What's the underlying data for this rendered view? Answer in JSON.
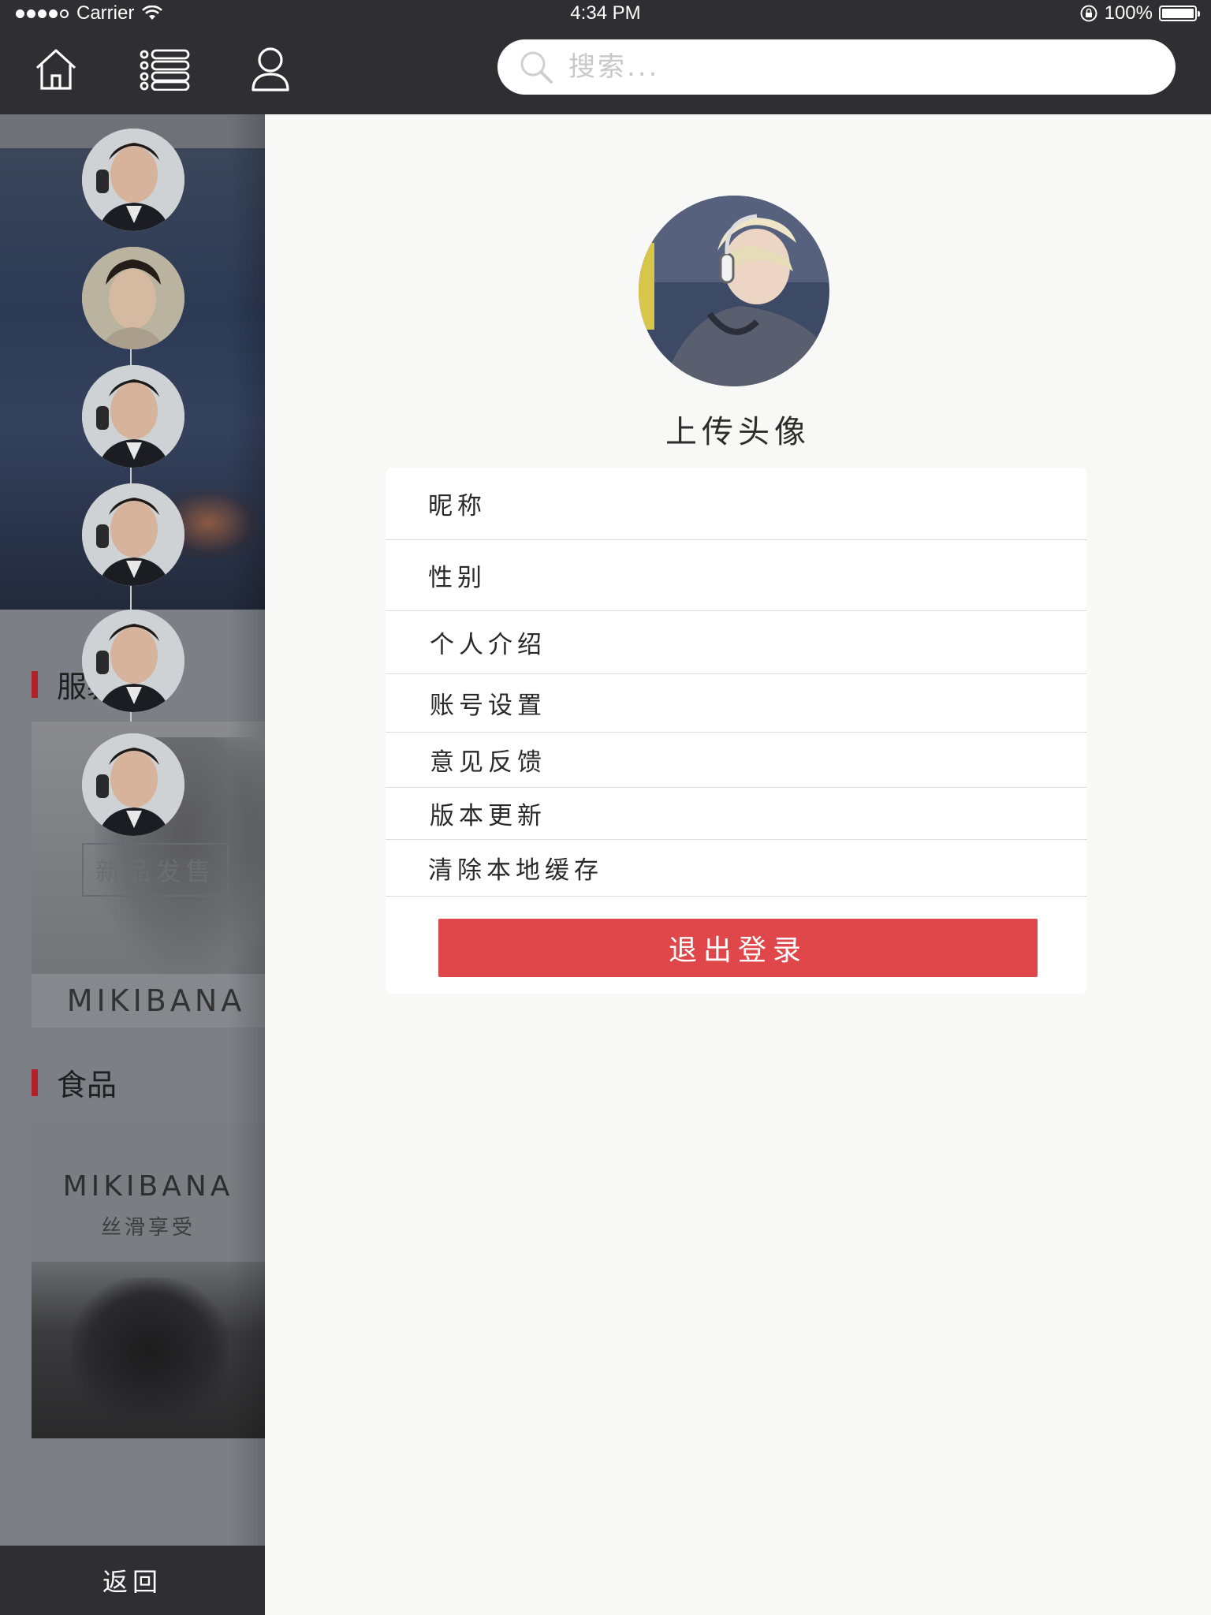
{
  "status_bar": {
    "carrier": "Carrier",
    "time": "4:34 PM",
    "battery": "100%"
  },
  "nav": {
    "icons": [
      "home-icon",
      "list-icon",
      "user-icon"
    ],
    "search_placeholder": "搜索..."
  },
  "drawer": {
    "sections": [
      {
        "title": "服装"
      },
      {
        "title": "食品"
      }
    ],
    "product1": {
      "tag": "新品发售",
      "brand": "MIKIBANA"
    },
    "product2": {
      "brand": "MIKIBANA",
      "subtitle": "丝滑享受"
    },
    "back_label": "返回"
  },
  "profile": {
    "upload_label": "上传头像",
    "menu": [
      {
        "label": "昵称"
      },
      {
        "label": "性别"
      },
      {
        "label": "个人介绍"
      },
      {
        "label": "账号设置"
      },
      {
        "label": "意见反馈"
      },
      {
        "label": "版本更新"
      },
      {
        "label": "清除本地缓存"
      }
    ],
    "logout_label": "退出登录"
  },
  "colors": {
    "bar_bg": "#2e2e33",
    "accent_red": "#e0474a",
    "section_marker": "#b3202a"
  }
}
